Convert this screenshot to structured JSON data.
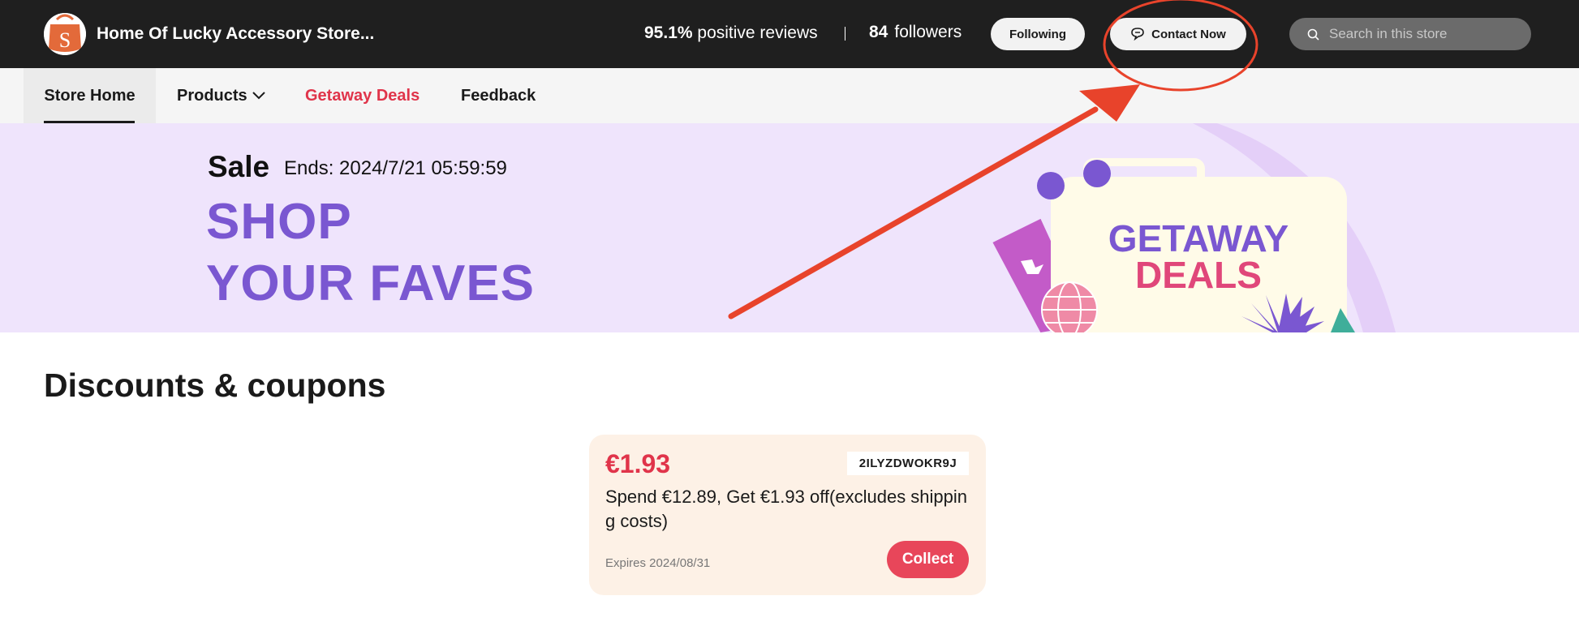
{
  "header": {
    "store_name": "Home Of Lucky Accessory Store...",
    "positive_pct": "95.1%",
    "positive_label": "positive reviews",
    "followers_count": "84",
    "followers_label": "followers",
    "following_label": "Following",
    "contact_label": "Contact Now",
    "search_placeholder": "Search in this store",
    "logo_letter": "S"
  },
  "nav": {
    "items": [
      {
        "label": "Store Home",
        "active": true
      },
      {
        "label": "Products",
        "has_dropdown": true
      },
      {
        "label": "Getaway Deals",
        "color": "#e0344a"
      },
      {
        "label": "Feedback"
      }
    ]
  },
  "banner": {
    "sale_label": "Sale",
    "ends_text": "Ends: 2024/7/21 05:59:59",
    "headline_1": "SHOP",
    "headline_2": "YOUR FAVES",
    "art_line_1": "GETAWAY",
    "art_line_2": "DEALS",
    "background": "#efe4fc",
    "headline_color": "#7a57d1"
  },
  "discounts": {
    "title": "Discounts & coupons",
    "coupons": [
      {
        "amount": "€1.93",
        "code": "2ILYZDWOKR9J",
        "description": "Spend €12.89, Get €1.93 off(excludes shipping costs)",
        "expires": "Expires 2024/08/31",
        "collect_label": "Collect"
      }
    ]
  },
  "colors": {
    "header_bg": "#1f1f1f",
    "accent_red": "#e0344a",
    "annotation": "#e8432b"
  },
  "icons": {
    "logo": "shopping-bag-icon",
    "contact": "chat-bubble-icon",
    "search": "search-icon",
    "products_dropdown": "chevron-down-icon"
  }
}
